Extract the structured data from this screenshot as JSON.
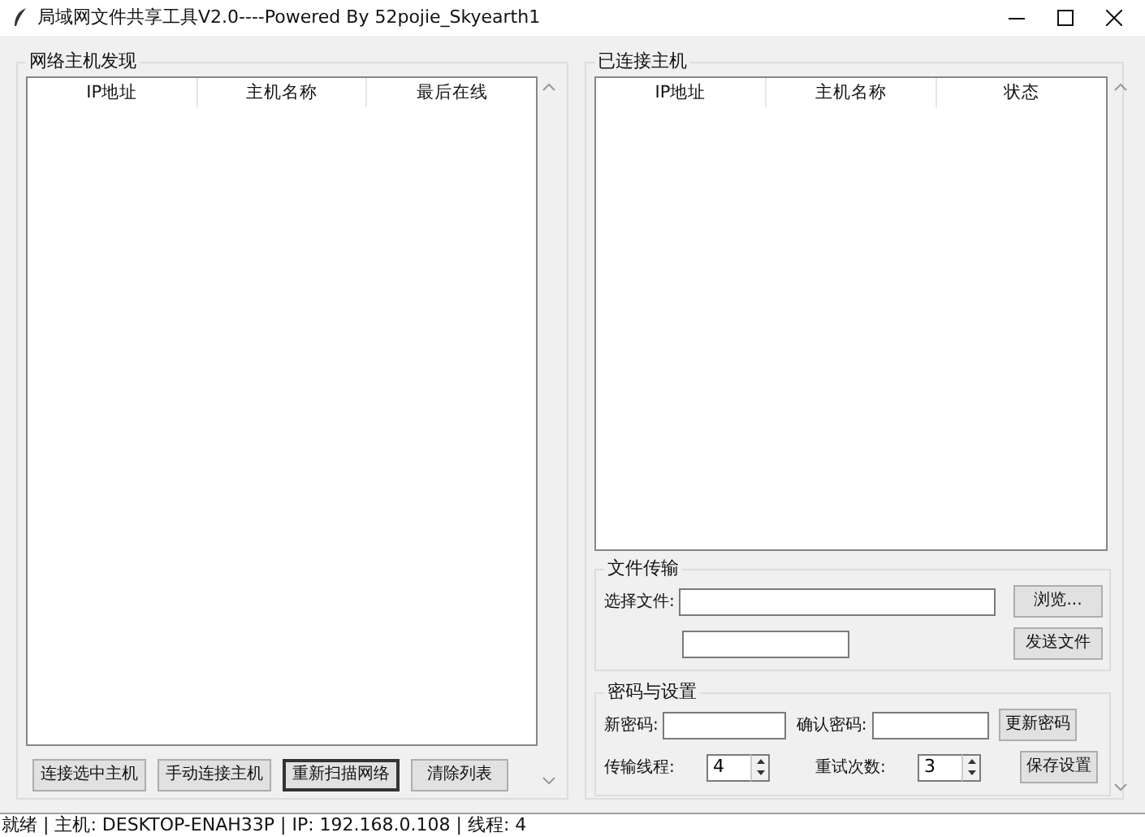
{
  "window": {
    "title": "局域网文件共享工具V2.0----Powered By 52pojie_Skyearth1"
  },
  "discovery": {
    "title": "网络主机发现",
    "columns": [
      "IP地址",
      "主机名称",
      "最后在线"
    ],
    "buttons": [
      {
        "label": "连接选中主机",
        "focused": false
      },
      {
        "label": "手动连接主机",
        "focused": false
      },
      {
        "label": "重新扫描网络",
        "focused": true
      },
      {
        "label": "清除列表",
        "focused": false
      }
    ]
  },
  "connected": {
    "title": "已连接主机",
    "columns": [
      "IP地址",
      "主机名称",
      "状态"
    ]
  },
  "file_transfer": {
    "title": "文件传输",
    "rows": [
      {
        "label": "选择文件:",
        "button": "浏览..."
      },
      {
        "button": "发送文件"
      }
    ]
  },
  "password_settings": {
    "title": "密码与设置",
    "password_fields": [
      {
        "label": "新密码:"
      },
      {
        "label": "确认密码:"
      }
    ],
    "update_button": "更新密码",
    "spinners": [
      {
        "label": "传输线程:",
        "value": "4"
      },
      {
        "label": "重试次数:",
        "value": "3"
      }
    ],
    "save_button": "保存设置"
  },
  "status_bar": "就绪 | 主机: DESKTOP-ENAH33P | IP: 192.168.0.108 | 线程: 4"
}
